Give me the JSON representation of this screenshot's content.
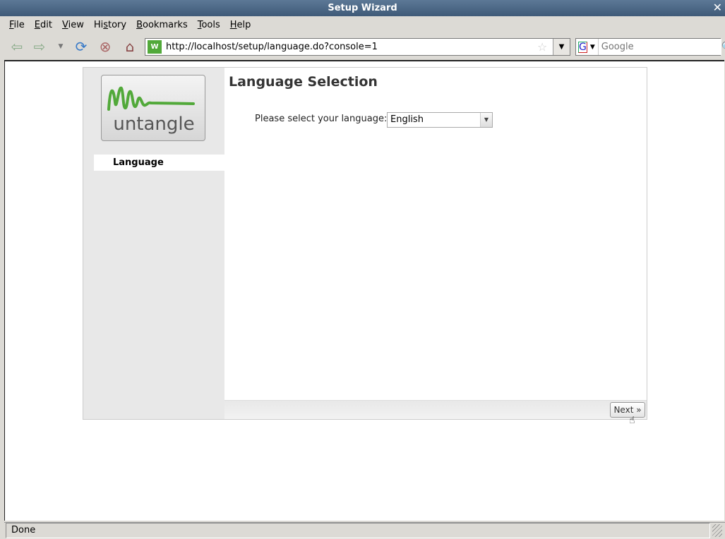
{
  "window": {
    "title": "Setup Wizard"
  },
  "menu": [
    "File",
    "Edit",
    "View",
    "History",
    "Bookmarks",
    "Tools",
    "Help"
  ],
  "menu_accel": [
    "F",
    "E",
    "V",
    "s",
    "B",
    "T",
    "H"
  ],
  "toolbar": {
    "url": "http://localhost/setup/language.do?console=1",
    "search_placeholder": "Google"
  },
  "wizard": {
    "logo_text": "untangle",
    "nav": [
      {
        "label": "Language",
        "active": true
      }
    ],
    "heading": "Language Selection",
    "language_label": "Please select your language:",
    "language_value": "English",
    "next_label": "Next »"
  },
  "status": {
    "text": "Done"
  },
  "colors": {
    "brand_green": "#52a93a",
    "titlebar": "#4a6582"
  }
}
